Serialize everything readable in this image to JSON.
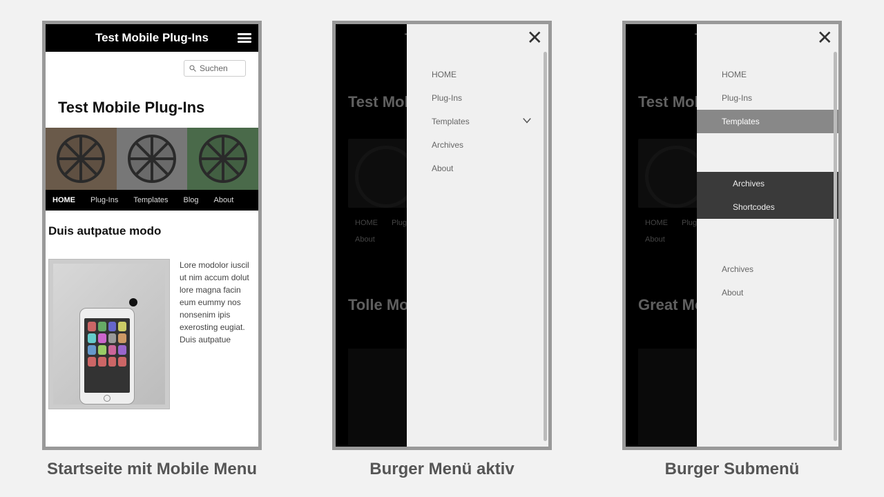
{
  "captions": {
    "c1": "Startseite mit Mobile Menu",
    "c2": "Burger Menü aktiv",
    "c3": "Burger Submenü"
  },
  "p1": {
    "header_title": "Test Mobile Plug-Ins",
    "search_placeholder": "Suchen",
    "page_heading": "Test Mobile Plug-Ins",
    "nav": {
      "home": "HOME",
      "plugins": "Plug-Ins",
      "templates": "Templates",
      "blog": "Blog",
      "about": "About"
    },
    "post_heading": "Duis autpatue modo",
    "post_text": "Lore modolor iuscil ut nim accum dolut lore magna facin eum eummy nos nonsenim ipis exerosting eugiat. Duis autpatue"
  },
  "p2": {
    "bg_title_frag": "Test Mobil",
    "bg_nav": {
      "home": "HOME",
      "plugins": "Plug-In",
      "about": "About"
    },
    "bg_h2": "Tolle Mo",
    "menu": {
      "home": "HOME",
      "plugins": "Plug-Ins",
      "templates": "Templates",
      "archives": "Archives",
      "about": "About"
    }
  },
  "p3": {
    "bg_title_frag": "Test Mobi",
    "bg_nav": {
      "home": "HOME",
      "plugins": "Plug-In",
      "about": "About"
    },
    "bg_h2": "Great Mo",
    "menu": {
      "home": "HOME",
      "plugins": "Plug-Ins",
      "templates": "Templates",
      "sub_archives": "Archives",
      "sub_shortcodes": "Shortcodes",
      "archives": "Archives",
      "about": "About"
    }
  }
}
